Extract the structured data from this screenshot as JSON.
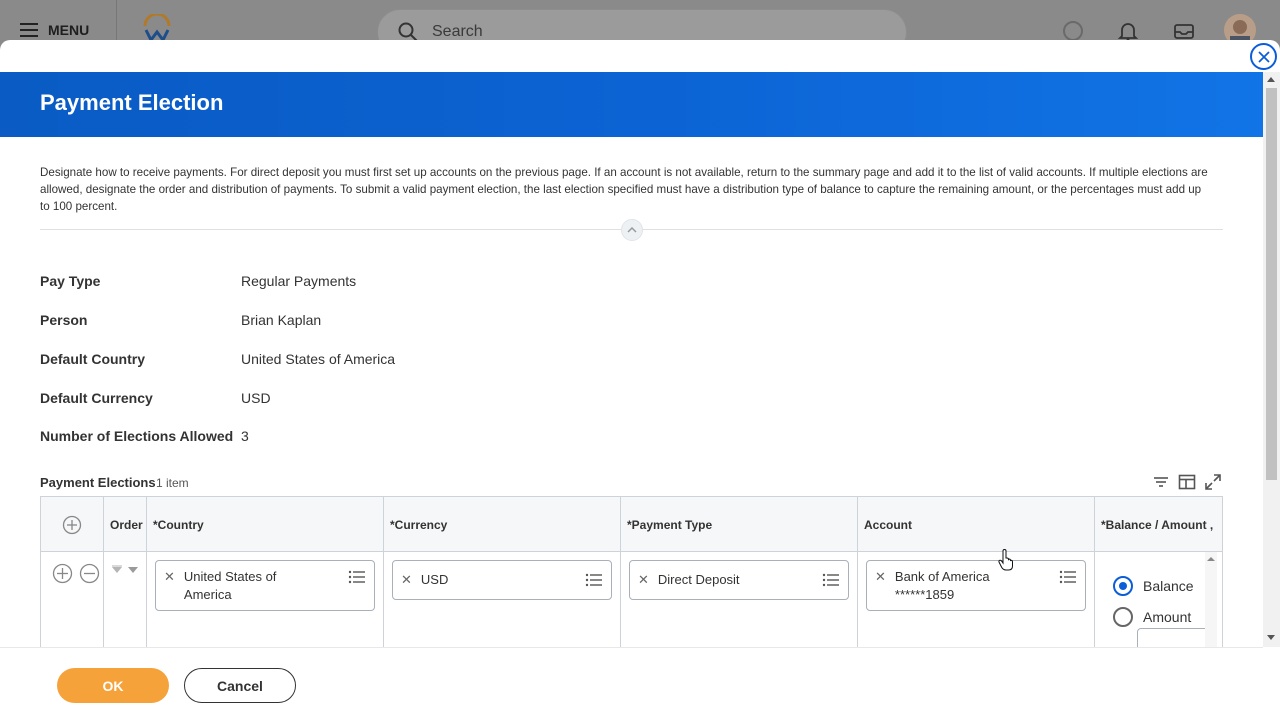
{
  "appbar": {
    "menu_label": "MENU",
    "search_placeholder": "Search"
  },
  "modal": {
    "title": "Payment Election",
    "description": "Designate how to receive payments. For direct deposit you must first set up accounts on the previous page. If an account is not available, return to the summary page and add it to the list of valid accounts. If multiple elections are allowed, designate the order and distribution of payments. To submit a valid payment election, the last election specified must have a distribution type of balance to capture the remaining amount, or the percentages must add up to 100 percent."
  },
  "fields": [
    {
      "label": "Pay Type",
      "value": "Regular Payments"
    },
    {
      "label": "Person",
      "value": "Brian Kaplan"
    },
    {
      "label": "Default Country",
      "value": "United States of America"
    },
    {
      "label": "Default Currency",
      "value": "USD"
    },
    {
      "label": "Number of Elections Allowed",
      "value": "3"
    }
  ],
  "payment_elections": {
    "title": "Payment Elections",
    "count": "1 item",
    "columns": {
      "order": "Order",
      "country": "*Country",
      "currency": "*Currency",
      "payment_type": "*Payment Type",
      "account": "Account",
      "balance_amount": "*Balance / Amount ,"
    },
    "row": {
      "country_line1": "United States of",
      "country_line2": "America",
      "currency": "USD",
      "payment_type": "Direct Deposit",
      "account_line1": "Bank of America",
      "account_line2": "******1859",
      "distribution_options": [
        "Balance",
        "Amount"
      ],
      "distribution_selected": "Balance"
    }
  },
  "footer": {
    "ok_label": "OK",
    "cancel_label": "Cancel"
  },
  "colors": {
    "accent_blue": "#0b5ed7",
    "ok_orange": "#f5a23a"
  }
}
